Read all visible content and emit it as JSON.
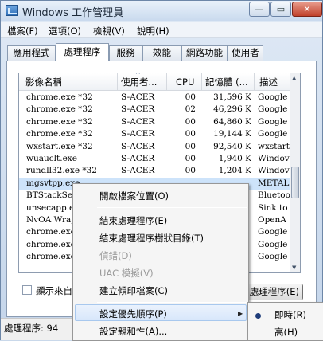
{
  "window": {
    "title": "Windows 工作管理員",
    "controls": {
      "minimize": "—",
      "maximize": "▭",
      "close": "✕"
    }
  },
  "menubar": [
    "檔案(F)",
    "選項(O)",
    "檢視(V)",
    "說明(H)"
  ],
  "tabs": [
    "應用程式",
    "處理程序",
    "服務",
    "效能",
    "網路功能",
    "使用者"
  ],
  "active_tab": "處理程序",
  "columns": [
    "影像名稱",
    "使用者...",
    "CPU",
    "記憶體 (...",
    "描述"
  ],
  "sort_arrow": "^",
  "rows": [
    {
      "name": "chrome.exe *32",
      "user": "S-ACER",
      "cpu": "00",
      "mem": "31,596 K",
      "desc": "Google"
    },
    {
      "name": "chrome.exe *32",
      "user": "S-ACER",
      "cpu": "02",
      "mem": "46,296 K",
      "desc": "Google"
    },
    {
      "name": "chrome.exe *32",
      "user": "S-ACER",
      "cpu": "00",
      "mem": "64,860 K",
      "desc": "Google"
    },
    {
      "name": "chrome.exe *32",
      "user": "S-ACER",
      "cpu": "00",
      "mem": "19,144 K",
      "desc": "Google"
    },
    {
      "name": "wxstart.exe *32",
      "user": "S-ACER",
      "cpu": "00",
      "mem": "92,540 K",
      "desc": "wxstart"
    },
    {
      "name": "wuauclt.exe",
      "user": "S-ACER",
      "cpu": "00",
      "mem": "1,940 K",
      "desc": "Windov"
    },
    {
      "name": "rundll32.exe *32",
      "user": "S-ACER",
      "cpu": "00",
      "mem": "1,204 K",
      "desc": "Windov"
    },
    {
      "name": "mgsvtpp.exe",
      "user": "",
      "cpu": "",
      "mem": "",
      "desc": "METAL"
    },
    {
      "name": "BTStackSer",
      "user": "",
      "cpu": "",
      "mem": "",
      "desc": "Bluetoo"
    },
    {
      "name": "unsecapp.ex",
      "user": "",
      "cpu": "",
      "mem": "",
      "desc": "Sink to"
    },
    {
      "name": "NvOA Wrap",
      "user": "",
      "cpu": "",
      "mem": "",
      "desc": "OpenA"
    },
    {
      "name": "chrome.exe",
      "user": "",
      "cpu": "",
      "mem": "",
      "desc": "Google"
    },
    {
      "name": "chrome.exe",
      "user": "",
      "cpu": "",
      "mem": "",
      "desc": "Google"
    },
    {
      "name": "chrome.exe",
      "user": "",
      "cpu": "",
      "mem": "",
      "desc": "Google"
    }
  ],
  "show_all_checkbox": "顯示來自",
  "end_process_button": "處理程序(E)",
  "status": {
    "processes": "處理程序: 94"
  },
  "context_menu": {
    "open_location": "開啟檔案位置(O)",
    "end_process": "結束處理程序(E)",
    "end_tree": "結束處理程序樹狀目錄(T)",
    "debug": "偵錯(D)",
    "uac_virtualization": "UAC 模擬(V)",
    "create_dump": "建立傾印檔案(C)",
    "set_priority": "設定優先順序(P)",
    "set_affinity": "設定親和性(A)..."
  },
  "priority_submenu": {
    "realtime": "即時(R)",
    "high": "高(H)"
  },
  "colors": {
    "selection": "#cde3fa",
    "menu_highlight": "#d8e7fb",
    "window_chrome": "#c4d5ea"
  }
}
